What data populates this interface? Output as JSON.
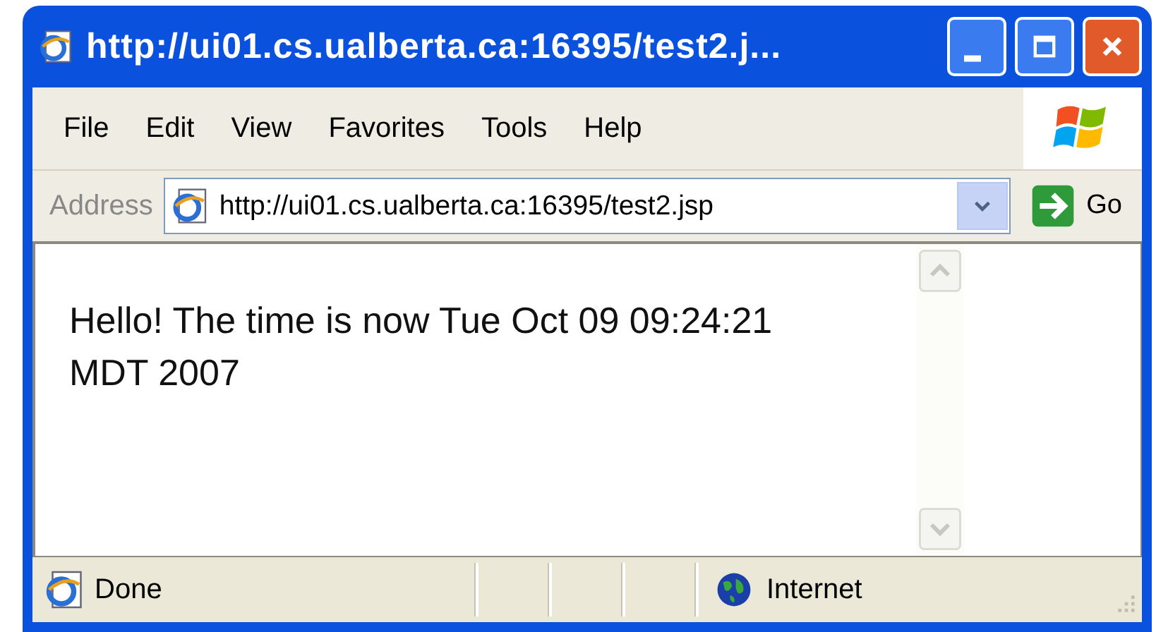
{
  "window": {
    "title": "http://ui01.cs.ualberta.ca:16395/test2.j..."
  },
  "menu": [
    "File",
    "Edit",
    "View",
    "Favorites",
    "Tools",
    "Help"
  ],
  "address_bar": {
    "label": "Address",
    "value": "http://ui01.cs.ualberta.ca:16395/test2.jsp",
    "go": "Go"
  },
  "content": {
    "text": "Hello! The time is now Tue Oct 09 09:24:21 MDT 2007"
  },
  "status_bar": {
    "text": "Done",
    "zone": "Internet"
  }
}
